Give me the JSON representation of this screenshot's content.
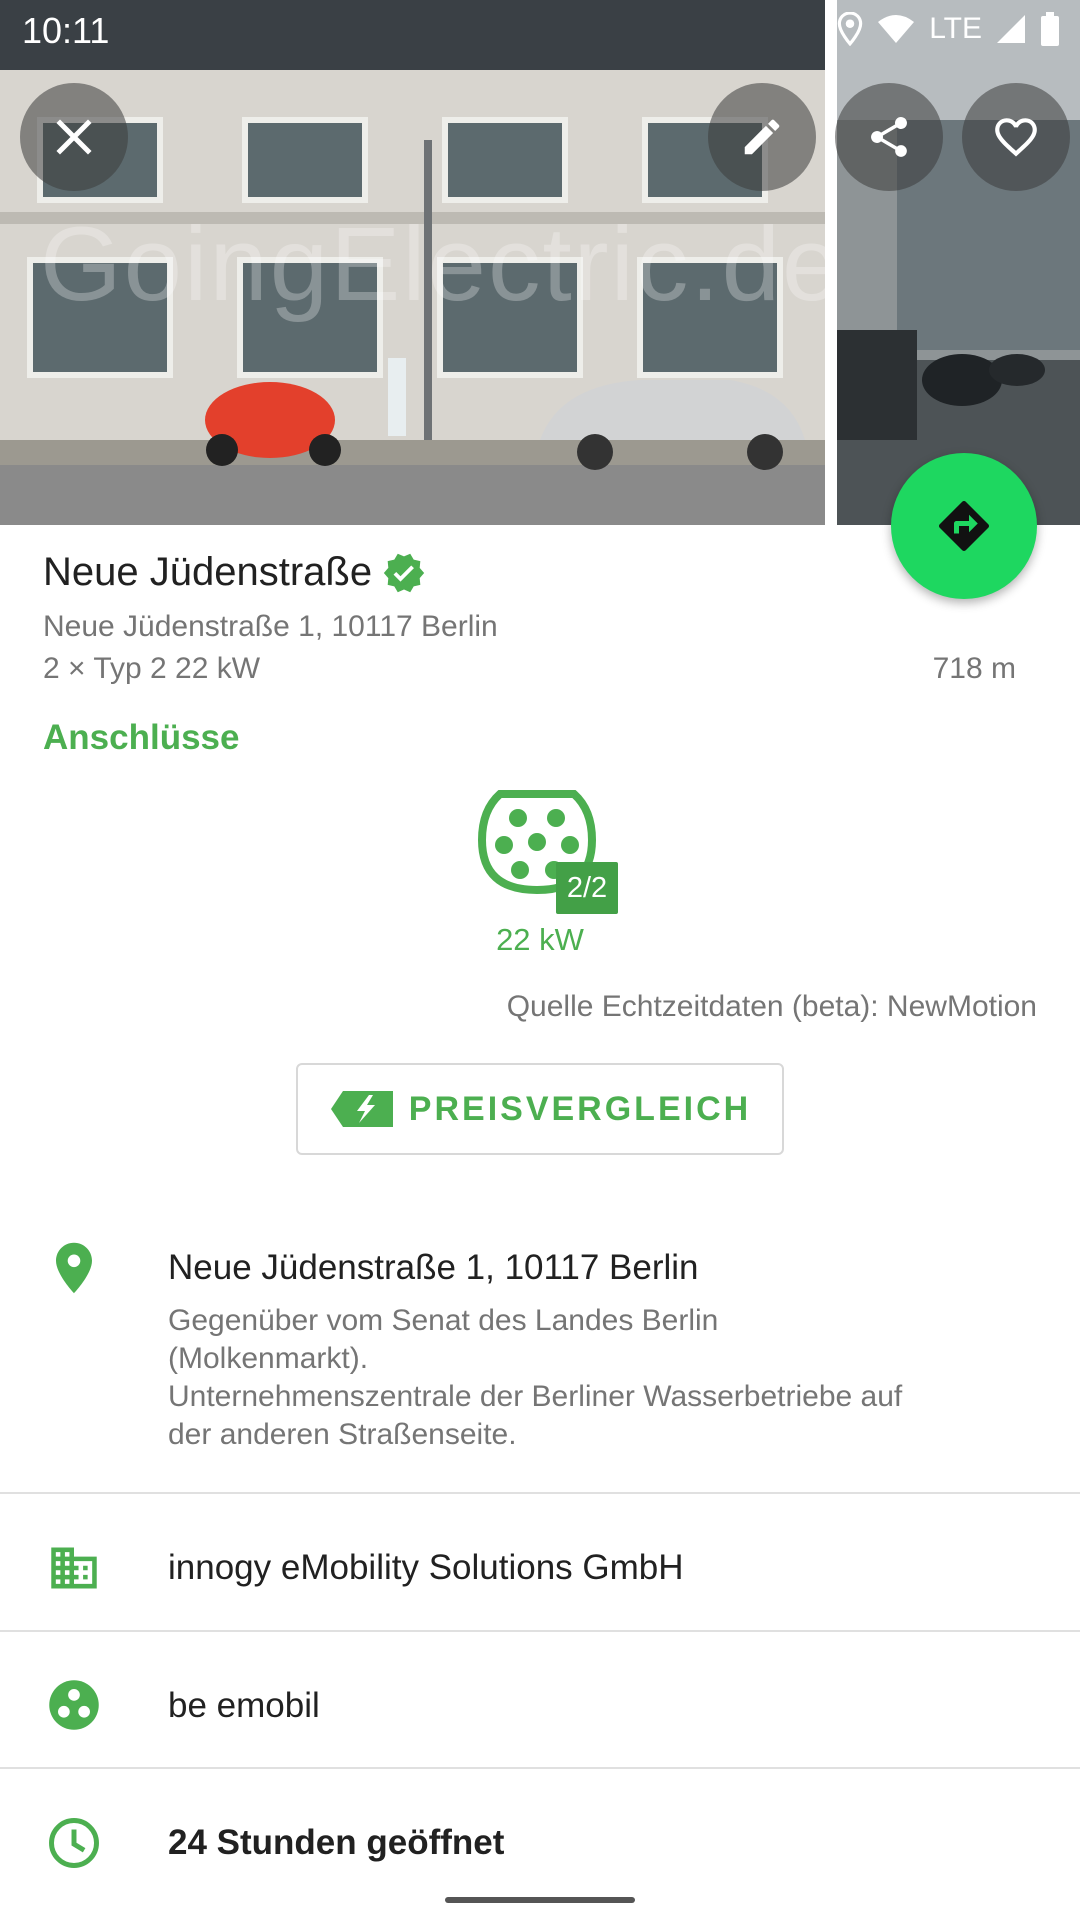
{
  "status_bar": {
    "time": "10:11",
    "network": "LTE"
  },
  "header": {
    "watermark": "GoingElectric.de",
    "buttons": {
      "close": "close-icon",
      "edit": "pencil-icon",
      "share": "share-icon",
      "favorite": "heart-icon"
    }
  },
  "station": {
    "name": "Neue Jüdenstraße",
    "verified_icon": "verified-badge-icon",
    "address": "Neue Jüdenstraße 1, 10117 Berlin",
    "connectors_summary": "2 × Typ 2 22 kW",
    "distance": "718 m"
  },
  "connectors": {
    "section_title": "Anschlüsse",
    "items": [
      {
        "availability": "2/2",
        "power": "22 kW",
        "icon": "type2-plug-icon"
      }
    ],
    "source_note": "Quelle Echtzeitdaten (beta): NewMotion"
  },
  "price_compare": {
    "label": "PREISVERGLEICH",
    "icon": "price-tag-icon"
  },
  "details": {
    "address_main": "Neue Jüdenstraße 1, 10117 Berlin",
    "address_description": "Gegenüber vom Senat des Landes Berlin\n(Molkenmarkt).\nUnternehmenszentrale der Berliner Wasserbetriebe auf\nder anderen Straßenseite.",
    "operator": "innogy eMobility Solutions GmbH",
    "network": "be emobil",
    "opening_hours": "24 Stunden geöffnet"
  },
  "colors": {
    "accent": "#4caf50",
    "fab": "#1ed760",
    "text_primary": "#212121",
    "text_secondary": "#757575"
  }
}
